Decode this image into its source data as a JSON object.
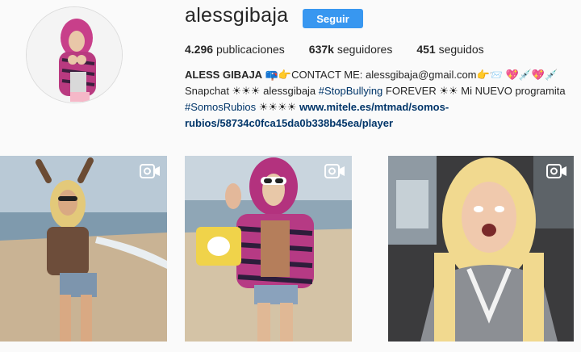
{
  "profile": {
    "username": "alessgibaja",
    "follow_label": "Seguir",
    "stats": {
      "posts_count": "4.296",
      "posts_label": "publicaciones",
      "followers_count": "637k",
      "followers_label": "seguidores",
      "following_count": "451",
      "following_label": "seguidos"
    },
    "bio": {
      "name": "ALESS GIBAJA",
      "line1_rest": " 📪👉CONTACT ME: alessgibaja@gmail.com👉📨 💖💉💖💉",
      "line2_start": "Snapchat ☀☀☀ alessgibaja  ",
      "line2_hashtag": "#StopBullying",
      "line2_end": " FOREVER ☀☀ Mi NUEVO programita",
      "line3_hashtag": "#SomosRubios",
      "line3_mid": " ☀☀☀☀ ",
      "line3_link": "www.mitele.es/mtmad/somos-",
      "line4_link": "rubios/58734c0fca15da0b338b45ea/player"
    }
  },
  "posts": [
    {
      "type": "video",
      "icon": "video-camera-icon"
    },
    {
      "type": "video",
      "icon": "video-camera-icon"
    },
    {
      "type": "video",
      "icon": "video-camera-icon"
    }
  ],
  "colors": {
    "follow_button": "#3897f0",
    "link": "#003569",
    "background": "#fafafa"
  }
}
